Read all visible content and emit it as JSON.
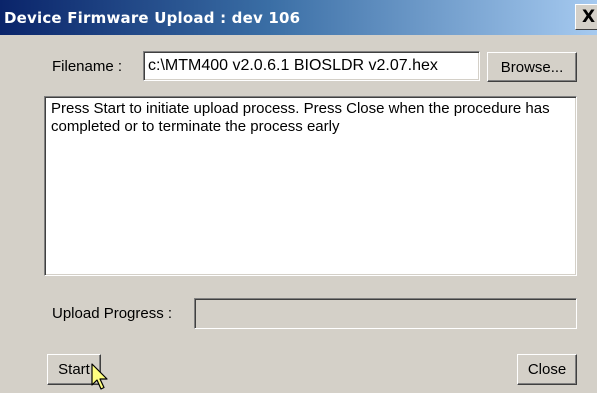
{
  "window": {
    "title": "Device Firmware Upload : dev 106",
    "close_glyph": "X"
  },
  "filename": {
    "label": "Filename :",
    "value": "c:\\MTM400 v2.0.6.1 BIOSLDR v2.07.hex",
    "browse_label": "Browse..."
  },
  "message": {
    "text": "Press Start to initiate upload process. Press Close when the procedure has completed or to terminate the process early"
  },
  "progress": {
    "label": "Upload Progress :",
    "value": 0
  },
  "buttons": {
    "start_label": "Start",
    "close_label": "Close"
  },
  "colors": {
    "title_gradient_start": "#0a246a",
    "title_gradient_end": "#a6caf0",
    "window_bg": "#d4d0c8",
    "cursor_fill": "#ffff80"
  },
  "icons": {
    "title_close": "close-icon",
    "pointer": "mouse-pointer-icon"
  }
}
